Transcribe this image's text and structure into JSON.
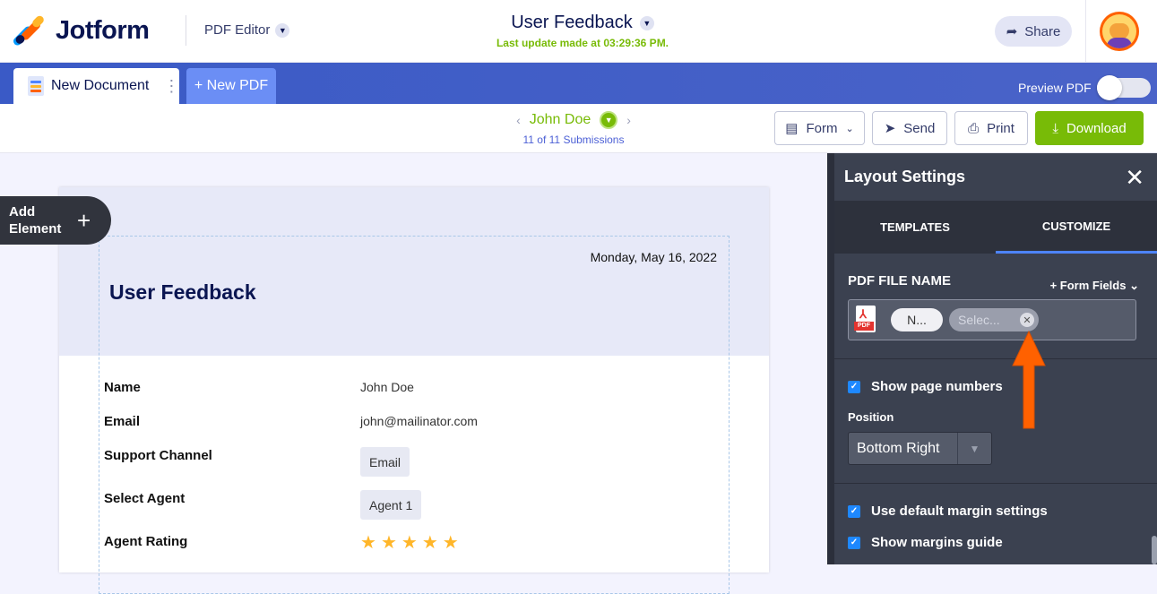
{
  "header": {
    "brand": "Jotform",
    "editor_label": "PDF Editor",
    "doc_title": "User Feedback",
    "last_update": "Last update made at 03:29:36 PM.",
    "share_label": "Share"
  },
  "tabs": {
    "active_label": "New Document",
    "new_label": "+ New PDF",
    "preview_label": "Preview PDF"
  },
  "toolbar": {
    "submitter": "John Doe",
    "submission_count": "11 of 11 Submissions",
    "form_label": "Form",
    "send_label": "Send",
    "print_label": "Print",
    "download_label": "Download"
  },
  "document": {
    "add_element_label_1": "Add",
    "add_element_label_2": "Element",
    "date": "Monday, May 16, 2022",
    "title": "User Feedback",
    "fields": [
      {
        "label": "Name",
        "value": "John Doe"
      },
      {
        "label": "Email",
        "value": "john@mailinator.com"
      },
      {
        "label": "Support Channel",
        "value": "Email"
      },
      {
        "label": "Select Agent",
        "value": "Agent 1"
      },
      {
        "label": "Agent Rating",
        "value": "5 of 5 stars"
      }
    ],
    "rating": 5
  },
  "panel": {
    "title": "Layout Settings",
    "tab_templates": "TEMPLATES",
    "tab_customize": "CUSTOMIZE",
    "pdf_file_name_label": "PDF FILE NAME",
    "form_fields_label": "+ Form Fields",
    "pill_name": "N...",
    "pill_select": "Selec...",
    "show_page_numbers": "Show page numbers",
    "position_label": "Position",
    "position_value": "Bottom Right",
    "use_default_margin": "Use default margin settings",
    "show_margins_guide": "Show margins guide"
  },
  "colors": {
    "accent_green": "#78bb07",
    "tab_blue": "#3e5ec8",
    "panel_dark": "#3b4150",
    "arrow_orange": "#ff6100"
  }
}
